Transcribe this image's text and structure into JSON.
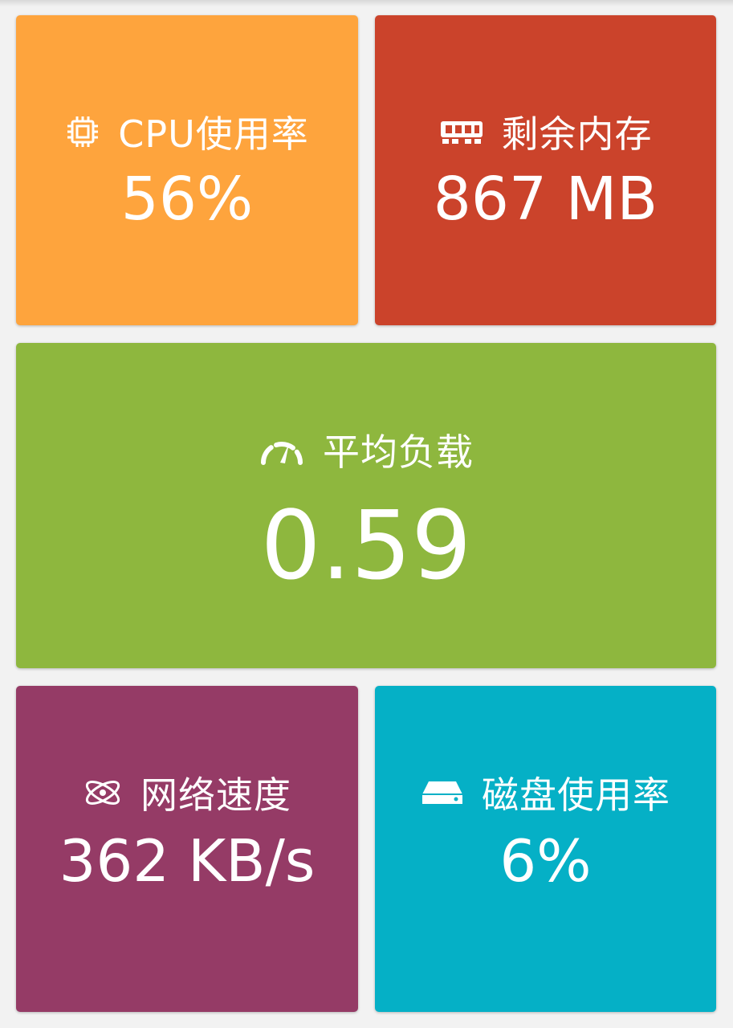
{
  "tiles": {
    "cpu": {
      "label": "CPU使用率",
      "value": "56%",
      "icon": "cpu-chip-icon",
      "color": "#fea43d"
    },
    "memory": {
      "label": "剩余内存",
      "value": "867 MB",
      "icon": "memory-stick-icon",
      "color": "#cb432b"
    },
    "load": {
      "label": "平均负载",
      "value": "0.59",
      "icon": "speedometer-icon",
      "color": "#8eb73e"
    },
    "network": {
      "label": "网络速度",
      "value": "362 KB/s",
      "icon": "atom-icon",
      "color": "#953b66"
    },
    "disk": {
      "label": "磁盘使用率",
      "value": "6%",
      "icon": "hard-drive-icon",
      "color": "#05b0c6"
    }
  }
}
